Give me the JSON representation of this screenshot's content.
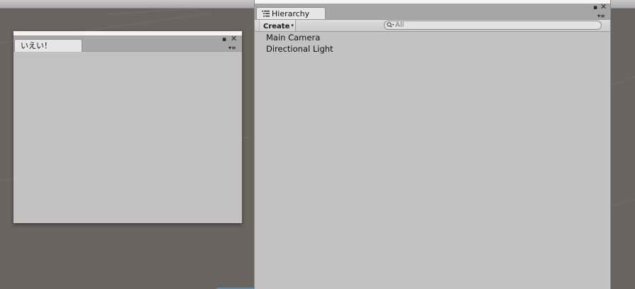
{
  "floating_window": {
    "tab_label": "いえい！",
    "maximize_glyph": "▪",
    "close_glyph": "✕",
    "menu_glyph": "▾≡"
  },
  "hierarchy": {
    "tab_label": "Hierarchy",
    "create_label": "Create",
    "create_arrow": "▾",
    "search_placeholder": "All",
    "maximize_glyph": "▪",
    "close_glyph": "✕",
    "menu_glyph": "▾≡",
    "items": [
      {
        "label": "Main Camera"
      },
      {
        "label": "Directional Light"
      }
    ]
  },
  "colors": {
    "scene_background": "#6a645f",
    "panel_background": "#c2c2c2",
    "tabbar_background": "#a6a6a6",
    "accent": "#4f8fc8"
  }
}
